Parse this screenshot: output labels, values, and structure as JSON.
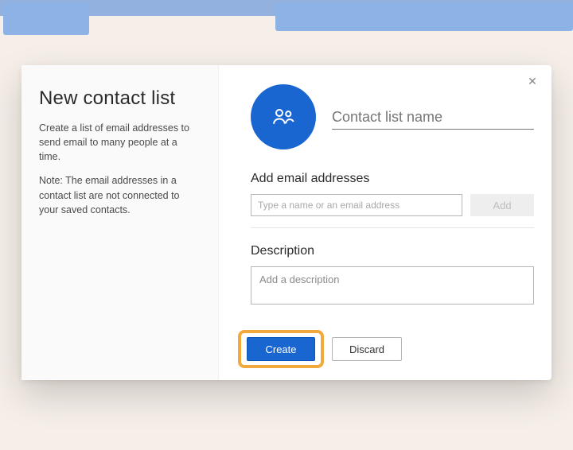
{
  "colors": {
    "primary": "#1a66d1",
    "highlight": "#f2a93b"
  },
  "sidebar": {
    "title": "New contact list",
    "intro": "Create a list of email addresses to send email to many people at a time.",
    "note": "Note: The email addresses in a contact list are not connected to your saved contacts."
  },
  "form": {
    "name_placeholder": "Contact list name",
    "name_value": "",
    "emails_label": "Add email addresses",
    "email_placeholder": "Type a name or an email address",
    "email_value": "",
    "add_label": "Add",
    "description_label": "Description",
    "description_placeholder": "Add a description",
    "description_value": ""
  },
  "buttons": {
    "create": "Create",
    "discard": "Discard",
    "close_glyph": "✕"
  },
  "icon": {
    "avatar_semantic": "contact-group-icon"
  }
}
